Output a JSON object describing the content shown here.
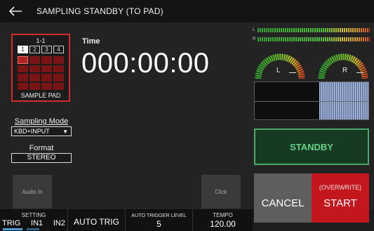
{
  "titlebar": {
    "title": "SAMPLING STANDBY (TO PAD)"
  },
  "pad": {
    "id": "1-1",
    "banks": [
      "1",
      "2",
      "3",
      "4"
    ],
    "selected_bank": 1,
    "label": "SAMPLE PAD"
  },
  "time": {
    "label": "Time",
    "value": "000:00:00"
  },
  "sampling_mode": {
    "label": "Sampling Mode",
    "value": "KBD+INPUT",
    "caret": "▼"
  },
  "format": {
    "label": "Format",
    "value": "STEREO"
  },
  "side_buttons": {
    "audio_in": "Audio In",
    "click": "Click"
  },
  "meters": {
    "left_label": "L",
    "right_label": "R"
  },
  "gauges": {
    "left_label": "L",
    "right_label": "R"
  },
  "status": {
    "text": "STANDBY"
  },
  "actions": {
    "cancel": "CANCEL",
    "start_sub": "(OVERWRITE)",
    "start": "START"
  },
  "bottom": {
    "setting": {
      "label": "SETTING",
      "options": [
        "TRIG",
        "IN1",
        "IN2"
      ]
    },
    "auto_trig": {
      "label": "AUTO TRIG"
    },
    "auto_trigger_level": {
      "label": "AUTO TRIGGER LEVEL",
      "value": "5"
    },
    "tempo": {
      "label": "TEMPO",
      "value": "120.00"
    }
  },
  "colors": {
    "accent_red": "#c4161d",
    "pad_border": "#d42a2a",
    "standby_green": "#66d28a",
    "trig_indicator": "#4e9ed8"
  },
  "icons": {
    "back": "arrow-left-icon"
  }
}
